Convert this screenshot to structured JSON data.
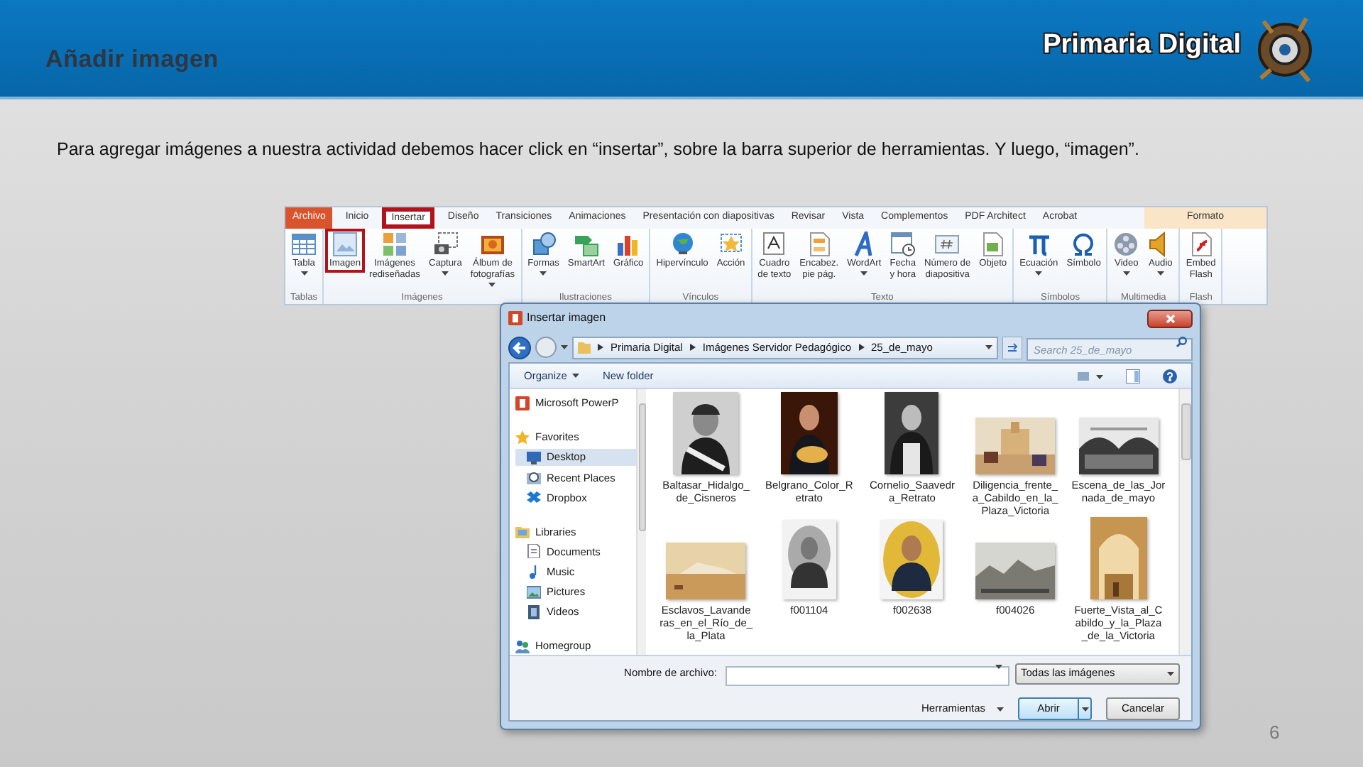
{
  "slide": {
    "title": "Añadir imagen",
    "brand": "Primaria Digital",
    "text": "Para agregar imágenes a nuestra actividad debemos hacer click en “insertar”, sobre la barra superior de herramientas. Y luego, “imagen”.",
    "page_number": "6"
  },
  "ribbon": {
    "tabs": [
      {
        "label": "Archivo",
        "kind": "file",
        "selected": false,
        "highlighted": false
      },
      {
        "label": "Inicio",
        "kind": "normal",
        "selected": false,
        "highlighted": false
      },
      {
        "label": "Insertar",
        "kind": "normal",
        "selected": true,
        "highlighted": true
      },
      {
        "label": "Diseño",
        "kind": "normal",
        "selected": false,
        "highlighted": false
      },
      {
        "label": "Transiciones",
        "kind": "normal",
        "selected": false,
        "highlighted": false
      },
      {
        "label": "Animaciones",
        "kind": "normal",
        "selected": false,
        "highlighted": false
      },
      {
        "label": "Presentación con diapositivas",
        "kind": "normal",
        "selected": false,
        "highlighted": false
      },
      {
        "label": "Revisar",
        "kind": "normal",
        "selected": false,
        "highlighted": false
      },
      {
        "label": "Vista",
        "kind": "normal",
        "selected": false,
        "highlighted": false
      },
      {
        "label": "Complementos",
        "kind": "normal",
        "selected": false,
        "highlighted": false
      },
      {
        "label": "PDF Architect",
        "kind": "normal",
        "selected": false,
        "highlighted": false
      },
      {
        "label": "Acrobat",
        "kind": "normal",
        "selected": false,
        "highlighted": false
      },
      {
        "label": "Formato",
        "kind": "contextual",
        "selected": false,
        "highlighted": false
      }
    ],
    "groups": [
      {
        "label": "Tablas",
        "buttons": [
          {
            "label": "Tabla",
            "dropdown": true,
            "highlighted": false
          }
        ]
      },
      {
        "label": "Imágenes",
        "buttons": [
          {
            "label": "Imagen",
            "dropdown": false,
            "highlighted": true
          },
          {
            "label": "Imágenes\nrediseñadas",
            "dropdown": false,
            "highlighted": false
          },
          {
            "label": "Captura",
            "dropdown": true,
            "highlighted": false
          },
          {
            "label": "Álbum de\nfotografías",
            "dropdown": true,
            "highlighted": false
          }
        ]
      },
      {
        "label": "Ilustraciones",
        "buttons": [
          {
            "label": "Formas",
            "dropdown": true,
            "highlighted": false
          },
          {
            "label": "SmartArt",
            "dropdown": false,
            "highlighted": false
          },
          {
            "label": "Gráfico",
            "dropdown": false,
            "highlighted": false
          }
        ]
      },
      {
        "label": "Vínculos",
        "buttons": [
          {
            "label": "Hipervínculo",
            "dropdown": false,
            "highlighted": false
          },
          {
            "label": "Acción",
            "dropdown": false,
            "highlighted": false
          }
        ]
      },
      {
        "label": "Texto",
        "buttons": [
          {
            "label": "Cuadro\nde texto",
            "dropdown": false,
            "highlighted": false
          },
          {
            "label": "Encabez.\npie pág.",
            "dropdown": false,
            "highlighted": false
          },
          {
            "label": "WordArt",
            "dropdown": true,
            "highlighted": false
          },
          {
            "label": "Fecha\ny hora",
            "dropdown": false,
            "highlighted": false
          },
          {
            "label": "Número de\ndiapositiva",
            "dropdown": false,
            "highlighted": false
          },
          {
            "label": "Objeto",
            "dropdown": false,
            "highlighted": false
          }
        ]
      },
      {
        "label": "Símbolos",
        "buttons": [
          {
            "label": "Ecuación",
            "dropdown": true,
            "highlighted": false
          },
          {
            "label": "Símbolo",
            "dropdown": false,
            "highlighted": false
          }
        ]
      },
      {
        "label": "Multimedia",
        "buttons": [
          {
            "label": "Video",
            "dropdown": true,
            "highlighted": false
          },
          {
            "label": "Audio",
            "dropdown": true,
            "highlighted": false
          }
        ]
      },
      {
        "label": "Flash",
        "buttons": [
          {
            "label": "Embed\nFlash",
            "dropdown": false,
            "highlighted": false
          }
        ]
      }
    ]
  },
  "dialog": {
    "title": "Insertar imagen",
    "breadcrumb": [
      "Primaria Digital",
      "Imágenes Servidor Pedagógico",
      "25_de_mayo"
    ],
    "search": {
      "placeholder": "Search 25_de_mayo"
    },
    "toolbar": [
      {
        "label": "Organize",
        "dropdown": true
      },
      {
        "label": "New folder",
        "dropdown": false
      }
    ],
    "nav": [
      {
        "label": "Microsoft PowerP",
        "kind": "app",
        "selected": false
      },
      {
        "label": "Favorites",
        "kind": "favorites",
        "selected": false,
        "children": [
          {
            "label": "Desktop",
            "kind": "desktop",
            "selected": true
          },
          {
            "label": "Recent Places",
            "kind": "recent",
            "selected": false
          },
          {
            "label": "Dropbox",
            "kind": "dropbox",
            "selected": false
          }
        ]
      },
      {
        "label": "Libraries",
        "kind": "libraries",
        "selected": false,
        "children": [
          {
            "label": "Documents",
            "kind": "documents",
            "selected": false
          },
          {
            "label": "Music",
            "kind": "music",
            "selected": false
          },
          {
            "label": "Pictures",
            "kind": "pictures",
            "selected": false
          },
          {
            "label": "Videos",
            "kind": "videos",
            "selected": false
          }
        ]
      },
      {
        "label": "Homegroup",
        "kind": "homegroup",
        "selected": false
      }
    ],
    "files": [
      {
        "name": "Baltasar_Hidalgo_\nde_Cisneros"
      },
      {
        "name": "Belgrano_Color_R\netrato"
      },
      {
        "name": "Cornelio_Saavedr\na_Retrato"
      },
      {
        "name": "Diligencia_frente_\na_Cabildo_en_la_\nPlaza_Victoria"
      },
      {
        "name": "Escena_de_las_Jor\nnada_de_mayo"
      },
      {
        "name": "Esclavos_Lavande\nras_en_el_Río_de_\nla_Plata"
      },
      {
        "name": "f001104"
      },
      {
        "name": "f002638"
      },
      {
        "name": "f004026"
      },
      {
        "name": "Fuerte_Vista_al_C\nabildo_y_la_Plaza\n_de_la_Victoria"
      }
    ],
    "file_name_label": "Nombre de archivo:",
    "file_type": "Todas las imágenes",
    "tools": "Herramientas",
    "buttons": [
      {
        "label": "Abrir",
        "kind": "split"
      },
      {
        "label": "Cancelar",
        "kind": "plain"
      }
    ]
  }
}
